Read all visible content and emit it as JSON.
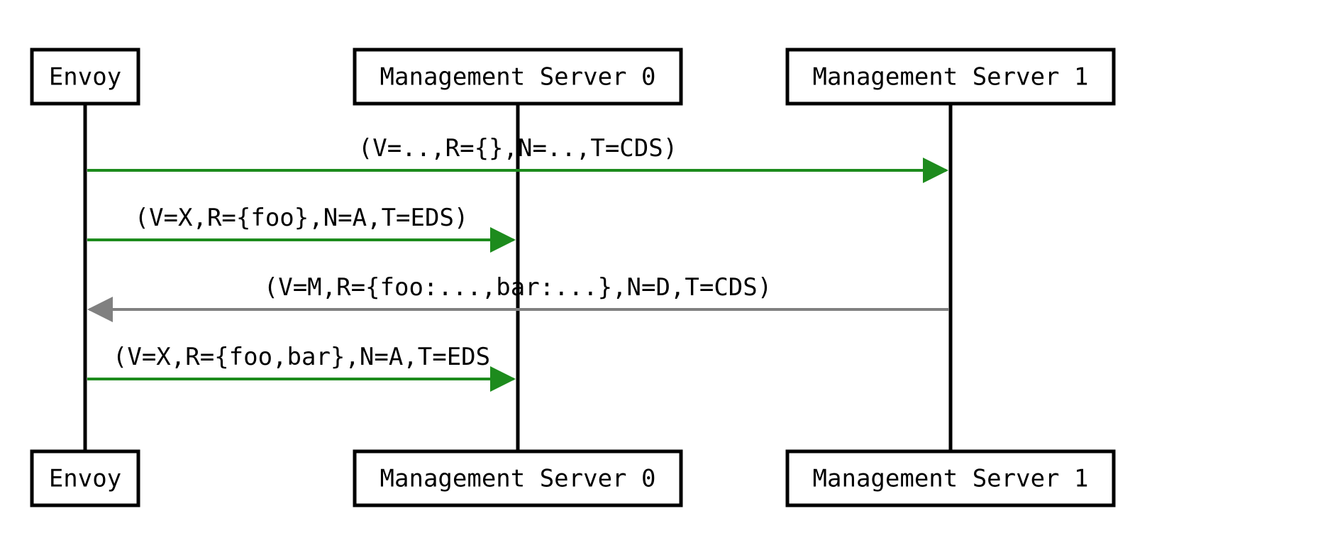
{
  "actors": {
    "envoy": {
      "label": "Envoy"
    },
    "ms0": {
      "label": "Management Server 0"
    },
    "ms1": {
      "label": "Management Server 1"
    }
  },
  "messages": {
    "m1": {
      "text": "(V=..,R={},N=..,T=CDS)"
    },
    "m2": {
      "text": "(V=X,R={foo},N=A,T=EDS)"
    },
    "m3": {
      "text": "(V=M,R={foo:...,bar:...},N=D,T=CDS)"
    },
    "m4": {
      "text": "(V=X,R={foo,bar},N=A,T=EDS"
    }
  },
  "colors": {
    "request": "#1d8b1d",
    "response": "#808080",
    "stroke": "#000000"
  }
}
